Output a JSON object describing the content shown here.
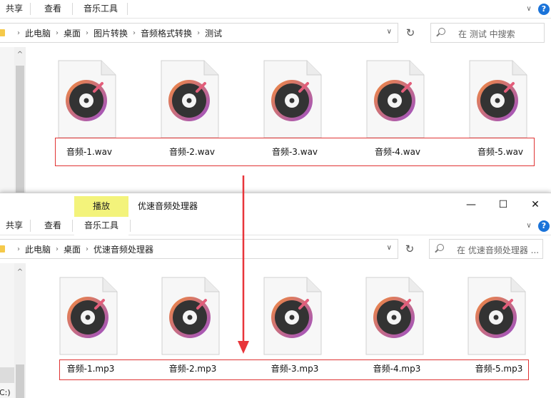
{
  "top_window": {
    "ribbon_tabs": [
      "共享",
      "查看",
      "音乐工具"
    ],
    "breadcrumb": [
      "此电脑",
      "桌面",
      "图片转换",
      "音频格式转换",
      "测试"
    ],
    "search_placeholder": "在 测试 中搜索",
    "files": [
      "音频-1.wav",
      "音频-2.wav",
      "音频-3.wav",
      "音频-4.wav",
      "音频-5.wav"
    ]
  },
  "bottom_window": {
    "context_tab": "播放",
    "window_title": "优速音频处理器",
    "ribbon_tabs": [
      "共享",
      "查看",
      "音乐工具"
    ],
    "breadcrumb": [
      "此电脑",
      "桌面",
      "优速音频处理器"
    ],
    "search_placeholder": "在 优速音频处理器 ...",
    "files": [
      "音频-1.mp3",
      "音频-2.mp3",
      "音频-3.mp3",
      "音频-4.mp3",
      "音频-5.mp3"
    ],
    "drive_fragment": "C:)"
  },
  "icons": {
    "help": "?",
    "minimize": "—",
    "maximize": "☐",
    "close": "✕",
    "refresh": "↻",
    "chevron_down": "∨",
    "chevron_up": "^",
    "breadcrumb_separator": "›"
  },
  "colors": {
    "highlight_box": "#e03434",
    "arrow": "#e8353a",
    "context_tab_bg": "#f3f37b",
    "help_blue": "#1a73d9",
    "music_ring_gradient_start": "#f28a3c",
    "music_ring_gradient_end": "#9b4fc9",
    "music_disc": "#333333"
  }
}
